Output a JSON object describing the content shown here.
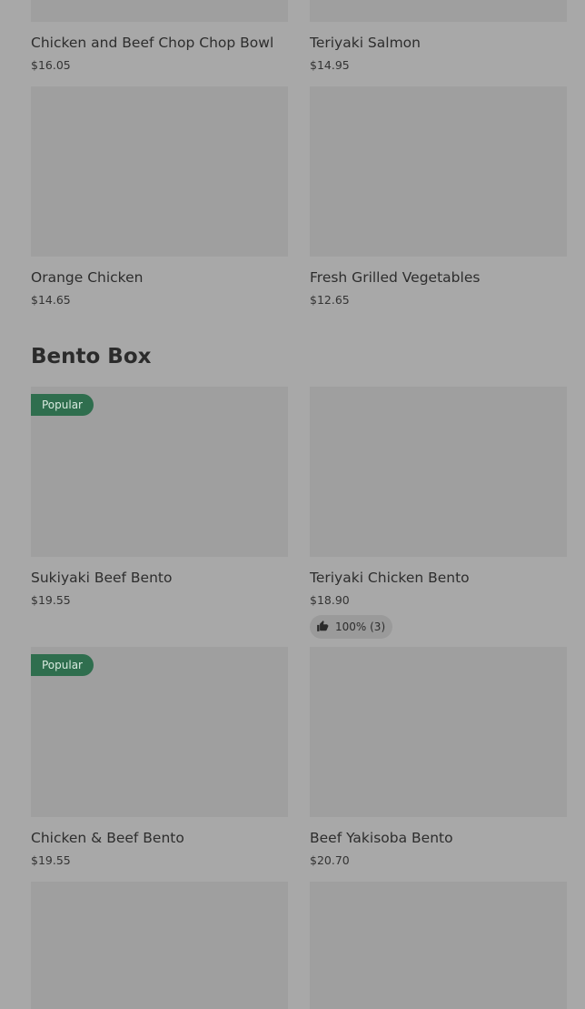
{
  "section_previous_items": [
    {
      "title": "Chicken and Beef Chop Chop Bowl",
      "price": "$16.05"
    },
    {
      "title": "Teriyaki Salmon",
      "price": "$14.95"
    },
    {
      "title": "Orange Chicken",
      "price": "$14.65"
    },
    {
      "title": "Fresh Grilled Vegetables",
      "price": "$12.65"
    }
  ],
  "bento_section": {
    "title": "Bento Box",
    "items": [
      {
        "title": "Sukiyaki Beef Bento",
        "price": "$19.55",
        "badge": "Popular"
      },
      {
        "title": "Teriyaki Chicken Bento",
        "price": "$18.90",
        "rating": "100% (3)",
        "rating_icon": "thumbs-up-icon"
      },
      {
        "title": "Chicken & Beef Bento",
        "price": "$19.55",
        "badge": "Popular"
      },
      {
        "title": "Beef Yakisoba Bento",
        "price": "$20.70"
      }
    ]
  },
  "colors": {
    "page_overlay": "#a8a8a8",
    "thumbnail": "#9f9f9f",
    "popular_badge": "#2f6e4e",
    "badge_text": "#d8eadf",
    "rating_pill": "#9a9a9a"
  }
}
